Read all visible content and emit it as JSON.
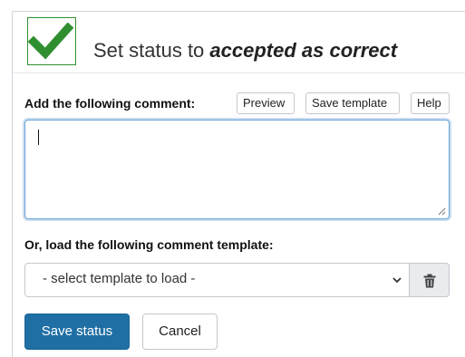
{
  "header": {
    "title_prefix": "Set status to ",
    "title_status": "accepted as correct",
    "icon": "check-icon",
    "icon_color": "#2f8f2f"
  },
  "comment": {
    "label": "Add the following comment:",
    "preview_label": "Preview",
    "save_template_label": "Save template",
    "help_label": "Help",
    "value": ""
  },
  "template": {
    "label": "Or, load the following comment template:",
    "selected": "- select template to load -",
    "delete_icon": "trash-icon"
  },
  "actions": {
    "save_label": "Save status",
    "cancel_label": "Cancel",
    "primary_color": "#1f6fa5"
  }
}
